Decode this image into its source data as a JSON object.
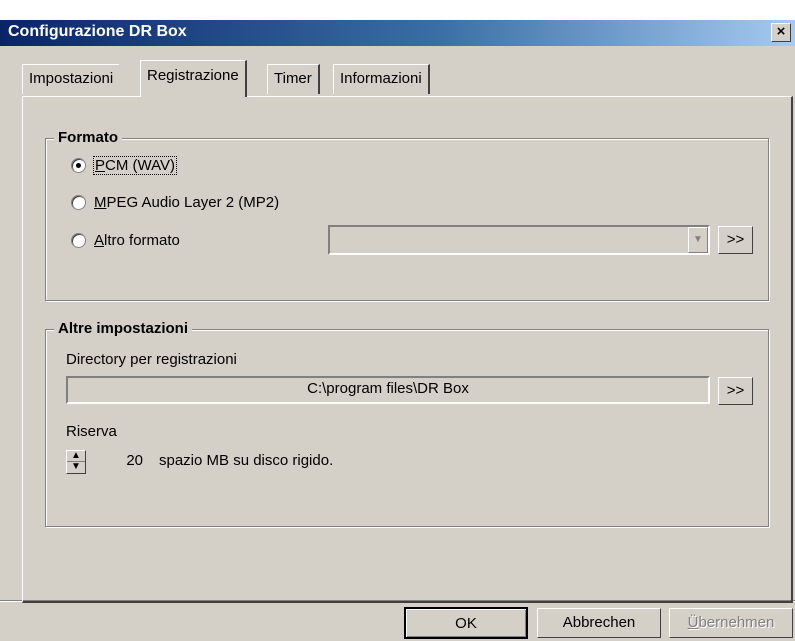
{
  "window": {
    "title": "Configurazione DR Box",
    "close_label": "×"
  },
  "tabs": [
    {
      "label": "Impostazioni",
      "active": false
    },
    {
      "label": "Registrazione",
      "active": true
    },
    {
      "label": "Timer",
      "active": false
    },
    {
      "label": "Informazioni",
      "active": false
    }
  ],
  "formato": {
    "title": "Formato",
    "options": [
      {
        "prefix": "",
        "mnemonic": "P",
        "rest": "CM (WAV)",
        "checked": true
      },
      {
        "prefix": "",
        "mnemonic": "M",
        "rest": "PEG Audio Layer 2 (MP2)",
        "checked": false
      },
      {
        "prefix": "",
        "mnemonic": "A",
        "rest": "ltro formato",
        "checked": false
      }
    ],
    "combo_value": "",
    "more_label": ">>"
  },
  "altre": {
    "title": "Altre impostazioni",
    "directory_label": "Directory per registrazioni",
    "directory_value": "C:\\program files\\DR Box",
    "browse_label": ">>",
    "riserva_label": "Riserva",
    "riserva_value": "20",
    "riserva_suffix": "spazio MB su disco rigido."
  },
  "buttons": {
    "ok": "OK",
    "cancel": "Abbrechen",
    "apply_mnemonic": "Ü",
    "apply_rest": "bernehmen"
  }
}
